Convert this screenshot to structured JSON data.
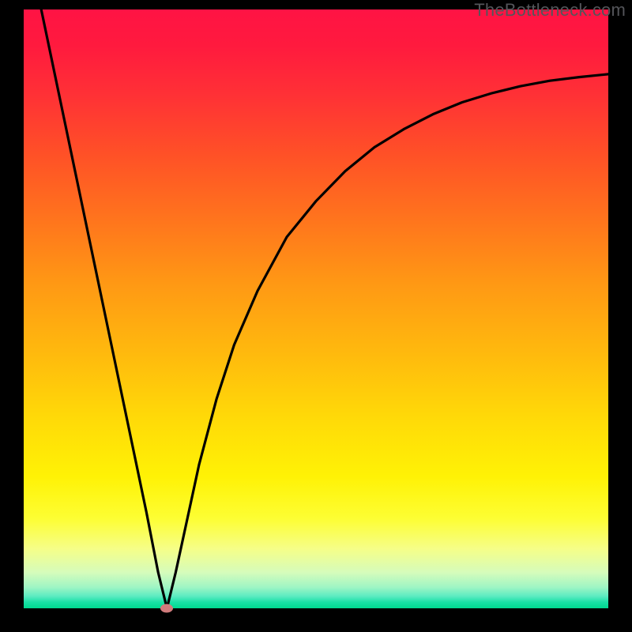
{
  "watermark": "TheBottleneck.com",
  "chart_data": {
    "type": "line",
    "title": "",
    "xlabel": "",
    "ylabel": "",
    "xlim": [
      0,
      100
    ],
    "ylim": [
      0,
      100
    ],
    "grid": false,
    "legend": false,
    "series": [
      {
        "name": "bottleneck-curve",
        "x": [
          3,
          6,
          9,
          12,
          15,
          18,
          21,
          23,
          24.5,
          26,
          28,
          30,
          33,
          36,
          40,
          45,
          50,
          55,
          60,
          65,
          70,
          75,
          80,
          85,
          90,
          95,
          100
        ],
        "y": [
          100,
          86,
          72,
          58,
          44,
          30,
          16,
          6,
          0,
          6,
          15,
          24,
          35,
          44,
          53,
          62,
          68,
          73,
          77,
          80,
          82.5,
          84.5,
          86,
          87.2,
          88.1,
          88.7,
          89.2
        ]
      }
    ],
    "marker": {
      "name": "optimal-point",
      "x": 24.5,
      "y": 0,
      "color": "#d17b7c"
    },
    "gradient_stops": [
      {
        "pos": 0,
        "color": "#ff1344"
      },
      {
        "pos": 50,
        "color": "#ff9914"
      },
      {
        "pos": 80,
        "color": "#fff205"
      },
      {
        "pos": 100,
        "color": "#00d98e"
      }
    ]
  }
}
